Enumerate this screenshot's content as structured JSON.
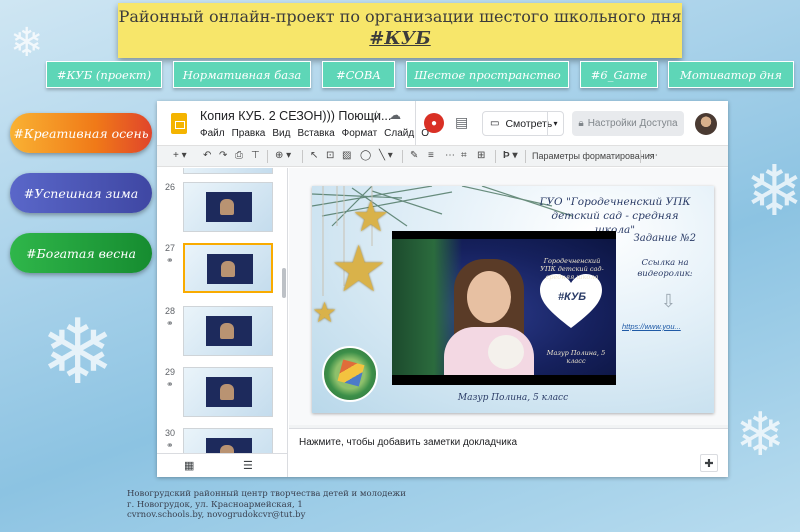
{
  "banner": {
    "title": "Районный онлайн-проект по организации шестого школьного дня",
    "subtitle": "#КУБ"
  },
  "nav": [
    {
      "label": "#КУБ (проект)"
    },
    {
      "label": "Нормативная база"
    },
    {
      "label": "#СОВА"
    },
    {
      "label": "Шестое пространство"
    },
    {
      "label": "#6_Game"
    },
    {
      "label": "Мотиватор дня"
    }
  ],
  "seasons": [
    {
      "label": "#Креативная осень",
      "color": "#f5931f"
    },
    {
      "label": "#Успешная зима",
      "color": "#4f58b8"
    },
    {
      "label": "#Богатая весна",
      "color": "#22a33c"
    }
  ],
  "slides_app": {
    "doc_title": "Копия КУБ. 2 СЕЗОН))) Поющи...",
    "menu": [
      "Файл",
      "Правка",
      "Вид",
      "Вставка",
      "Формат",
      "Слайд",
      "О"
    ],
    "present_label": "Смотреть",
    "access_label": "Настройки Доступа",
    "format_options_label": "Параметры форматирования",
    "zoom_symbol": "⊕",
    "slides": [
      {
        "num": "26"
      },
      {
        "num": "27"
      },
      {
        "num": "28"
      },
      {
        "num": "29"
      },
      {
        "num": "30"
      }
    ],
    "notes_placeholder": "Нажмите, чтобы добавить заметки докладчика",
    "accent_color": "#f9ab00"
  },
  "slide": {
    "org_line1": "ГУО \"Городечненский УПК",
    "org_line2": "детский сад - средняя школа\"",
    "task": "Задание №2",
    "link_label": "Ссылка на видеоролик:",
    "url": "https://www.you...",
    "video_caption": "Городечненский УПК детский сад-средняя школа",
    "video_name": "Мазур Полина, 5 класс",
    "heart_label": "#КУБ",
    "caption": "Мазур Полина, 5 класс"
  },
  "footer": {
    "line1": "Новогрудский районный центр творчества детей и молодежи",
    "line2": "г. Новогрудок, ул. Красноармейская, 1",
    "line3": "cvrnov.schools.by, novogrudokcvr@tut.by"
  }
}
